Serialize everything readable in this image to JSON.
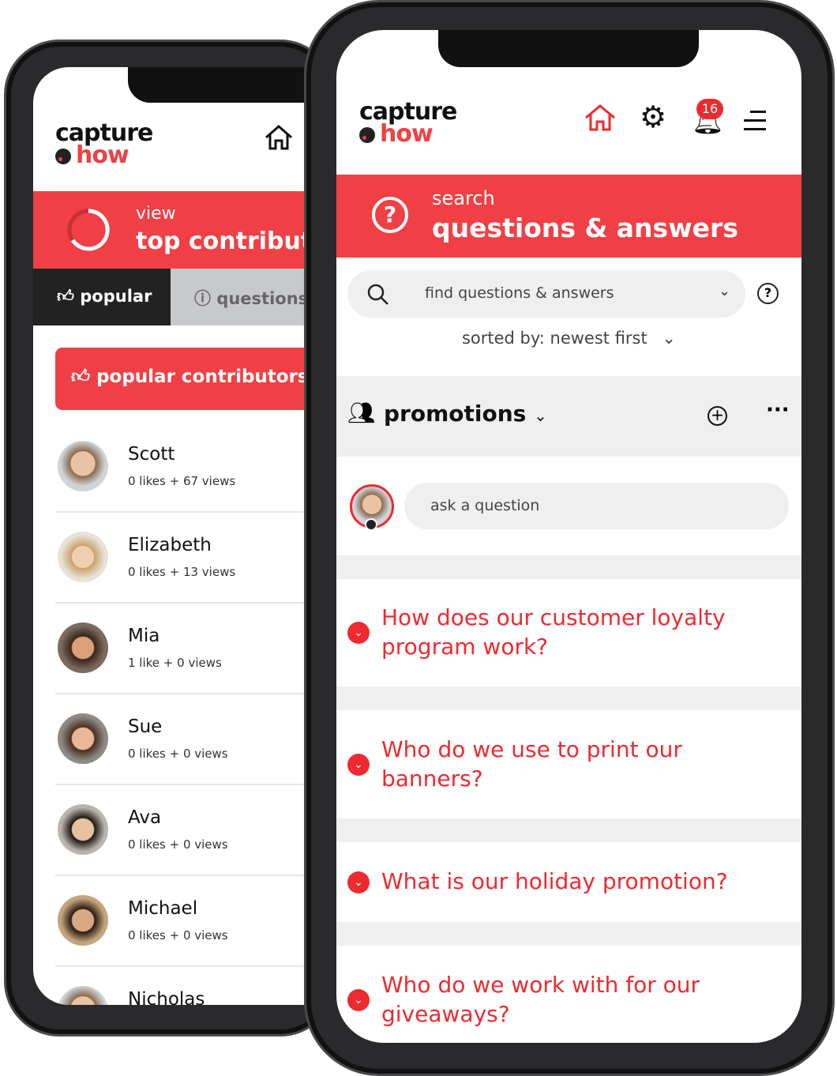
{
  "back_phone": {
    "logo": {
      "line1": "capture",
      "line2": "how"
    },
    "banner": {
      "small": "view",
      "large": "top contributors"
    },
    "tabs": [
      {
        "label": "popular",
        "icon": "thumbs-up-icon",
        "active": true
      },
      {
        "label": "questions",
        "icon": "question-circle-icon",
        "active": false
      }
    ],
    "section_button": "popular contributors",
    "contributors": [
      {
        "name": "Scott",
        "stats": "0 likes + 67 views"
      },
      {
        "name": "Elizabeth",
        "stats": "0 likes + 13 views"
      },
      {
        "name": "Mia",
        "stats": "1 like + 0 views"
      },
      {
        "name": "Sue",
        "stats": "0 likes + 0 views"
      },
      {
        "name": "Ava",
        "stats": "0 likes + 0 views"
      },
      {
        "name": "Michael",
        "stats": "0 likes + 0 views"
      },
      {
        "name": "Nicholas",
        "stats": ""
      }
    ]
  },
  "front_phone": {
    "logo": {
      "line1": "capture",
      "line2": "how"
    },
    "header": {
      "notification_count": "16"
    },
    "banner": {
      "small": "search",
      "large": "questions & answers"
    },
    "search": {
      "placeholder": "find questions & answers"
    },
    "sort": {
      "label": "sorted by: newest first"
    },
    "group": {
      "name": "promotions"
    },
    "ask": {
      "placeholder": "ask a question"
    },
    "questions": [
      "How does our customer loyalty program work?",
      "Who do we use to print our banners?",
      "What is our holiday promotion?",
      "Who do we work with for our giveaways?"
    ]
  },
  "colors": {
    "brand_red": "#f04045",
    "dark_tab": "#222222",
    "gray_tab": "#c8c9cc"
  }
}
